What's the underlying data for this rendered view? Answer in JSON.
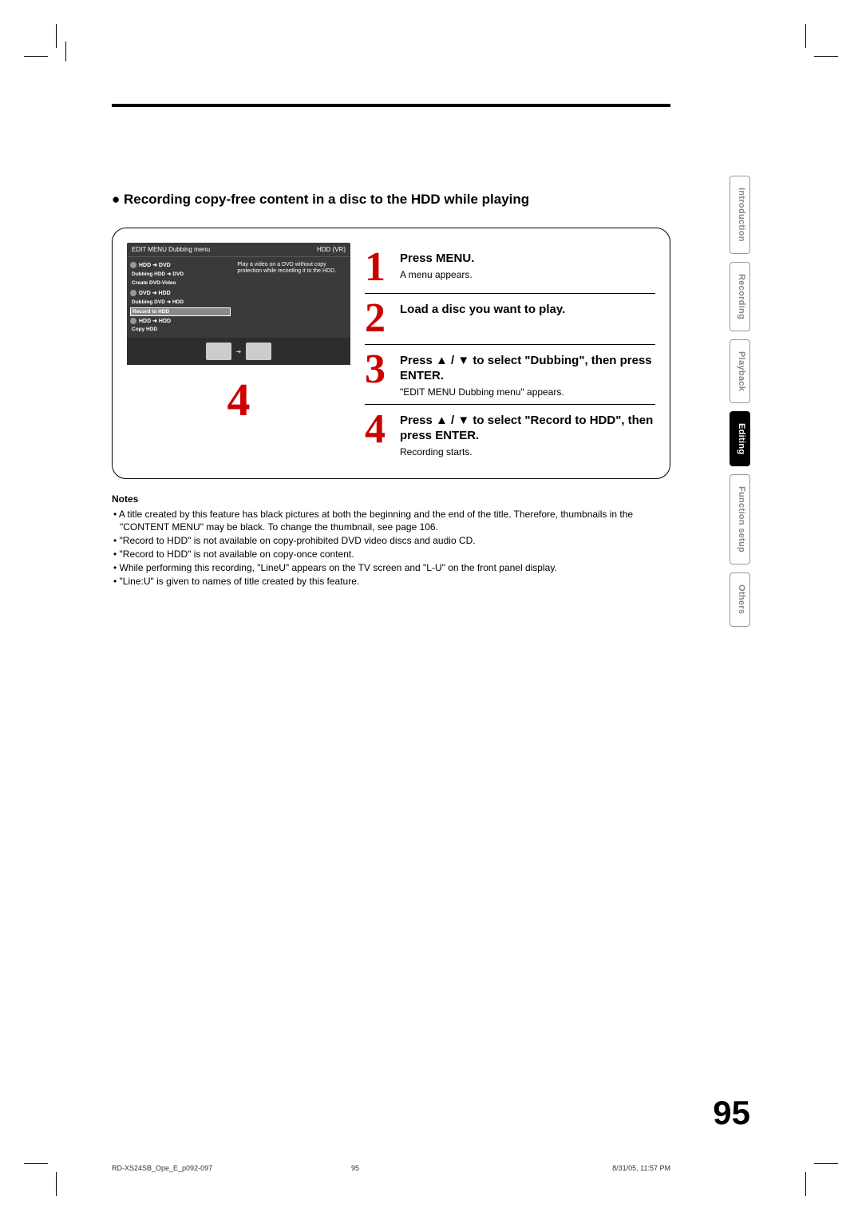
{
  "section_title": "●  Recording copy-free content in a disc to the HDD while playing",
  "menu": {
    "header_left": "EDIT MENU   Dubbing menu",
    "header_right": "HDD (VR)",
    "row1_icons": "HDD  ➜  DVD",
    "row1a": "Dubbing HDD ➜ DVD",
    "row1b": "Create DVD-Video",
    "right_desc": "Play a video on a DVD without copy protection while recording it to the HDD.",
    "row2_icons": "DVD  ➜  HDD",
    "row2a": "Dubbing DVD ➜ HDD",
    "row2b": "Record to HDD",
    "row3_icons": "HDD  ➜  HDD",
    "row3a": "Copy HDD"
  },
  "big4": "4",
  "steps": [
    {
      "n": "1",
      "title": "Press MENU.",
      "desc": "A menu appears."
    },
    {
      "n": "2",
      "title": "Load a disc you want to play.",
      "desc": ""
    },
    {
      "n": "3",
      "title": "Press ▲ / ▼ to select \"Dubbing\", then press ENTER.",
      "desc": "\"EDIT MENU Dubbing menu\" appears."
    },
    {
      "n": "4",
      "title": "Press ▲ / ▼ to select \"Record to HDD\", then press ENTER.",
      "desc": "Recording starts."
    }
  ],
  "notes_heading": "Notes",
  "notes": [
    "A title created by this feature has black pictures at both the beginning and the end of the title. Therefore, thumbnails in the \"CONTENT MENU\" may be black. To change the thumbnail, see      page 106.",
    "\"Record to HDD\" is not available on copy-prohibited DVD video discs and audio CD.",
    "\"Record to HDD\" is not available on copy-once content.",
    "While performing this recording, \"LineU\" appears on the TV screen and \"L-U\" on the front panel display.",
    "\"Line:U\" is given to names of title created by this feature."
  ],
  "tabs": [
    "Introduction",
    "Recording",
    "Playback",
    "Editing",
    "Function setup",
    "Others"
  ],
  "active_tab": "Editing",
  "page_number": "95",
  "footer": {
    "left": "RD-XS24SB_Ope_E_p092-097",
    "mid": "95",
    "right": "8/31/05, 11:57 PM"
  }
}
